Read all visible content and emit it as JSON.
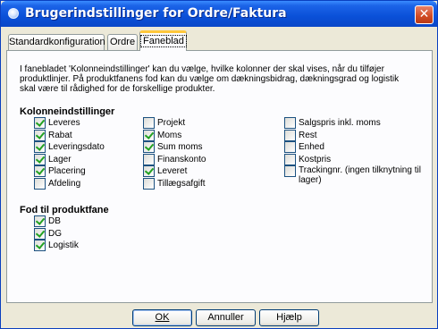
{
  "window": {
    "title": "Brugerindstillinger for Ordre/Faktura",
    "close_glyph": "✕"
  },
  "tabs": [
    {
      "label": "Standardkonfiguration",
      "active": false
    },
    {
      "label": "Ordre",
      "active": false
    },
    {
      "label": "Faneblad",
      "active": true
    }
  ],
  "description": "I fanebladet 'Kolonneindstillinger' kan du vælge, hvilke kolonner der skal vises, når du tilføjer produktlinjer. På produktfanens fod kan du vælge om dækningsbidrag, dækningsgrad og logistik skal være til rådighed for de forskellige produkter.",
  "columns_section": {
    "title": "Kolonneindstillinger",
    "col1": [
      {
        "label": "Leveres",
        "checked": true
      },
      {
        "label": "Rabat",
        "checked": true
      },
      {
        "label": "Leveringsdato",
        "checked": true
      },
      {
        "label": "Lager",
        "checked": true
      },
      {
        "label": "Placering",
        "checked": true
      },
      {
        "label": "Afdeling",
        "checked": false
      }
    ],
    "col2": [
      {
        "label": "Projekt",
        "checked": false
      },
      {
        "label": "Moms",
        "checked": true
      },
      {
        "label": "Sum moms",
        "checked": true
      },
      {
        "label": "Finanskonto",
        "checked": false
      },
      {
        "label": "Leveret",
        "checked": true
      },
      {
        "label": "Tillægsafgift",
        "checked": false
      }
    ],
    "col3": [
      {
        "label": "Salgspris inkl. moms",
        "checked": false
      },
      {
        "label": "Rest",
        "checked": false
      },
      {
        "label": "Enhed",
        "checked": false
      },
      {
        "label": "Kostpris",
        "checked": false
      },
      {
        "label": "Trackingnr. (ingen tilknytning til lager)",
        "checked": false
      }
    ]
  },
  "footer_section": {
    "title": "Fod til produktfane",
    "items": [
      {
        "label": "DB",
        "checked": true
      },
      {
        "label": "DG",
        "checked": true
      },
      {
        "label": "Logistik",
        "checked": true
      }
    ]
  },
  "buttons": {
    "ok": "OK",
    "cancel": "Annuller",
    "help": "Hjælp"
  }
}
